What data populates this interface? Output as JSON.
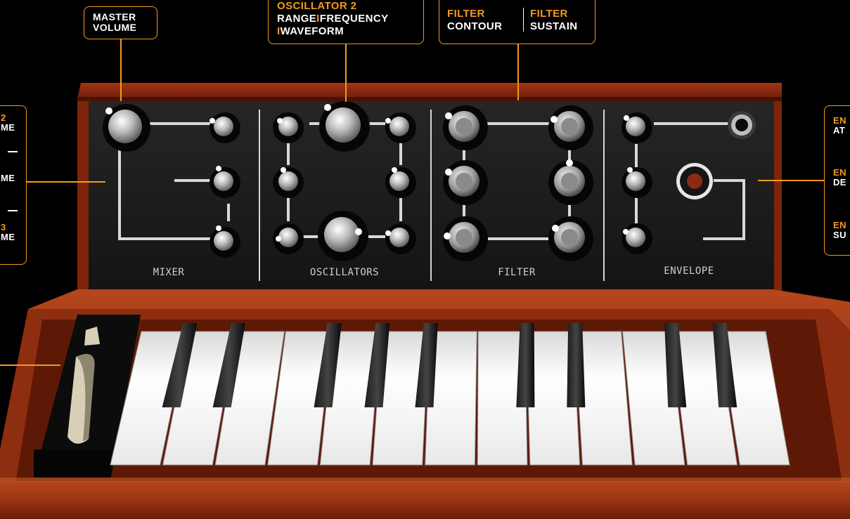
{
  "callouts": {
    "master_volume": {
      "line1": "MASTER",
      "line2": "VOLUME"
    },
    "oscillator2": {
      "title": "OSCILLATOR 2",
      "range": "RANGE",
      "sep1": "I",
      "frequency": "FREQUENCY",
      "sep2": "I",
      "waveform": "WAVEFORM"
    },
    "filter": {
      "contour_title": "FILTER",
      "contour": "CONTOUR",
      "sustain_title": "FILTER",
      "sustain": "SUSTAIN"
    },
    "left_mixer": [
      {
        "top": "2",
        "bottom": "ME"
      },
      {
        "top": "",
        "bottom": "ME"
      },
      {
        "top": "3",
        "bottom": "ME"
      }
    ],
    "right_envelope": [
      {
        "top": "EN",
        "bottom": "AT"
      },
      {
        "top": "EN",
        "bottom": "DE"
      },
      {
        "top": "EN",
        "bottom": "SU"
      }
    ]
  },
  "sections": {
    "mixer": "MIXER",
    "oscillators": "OSCILLATORS",
    "filter": "FILTER",
    "envelope": "ENVELOPE"
  },
  "colors": {
    "accent": "#f29a1f",
    "panel": "#1c1c1c",
    "wood": "#9a2c10",
    "trigger_led": "#8c2a14"
  },
  "keyboard": {
    "white_keys": 13,
    "black_keys": 9
  }
}
